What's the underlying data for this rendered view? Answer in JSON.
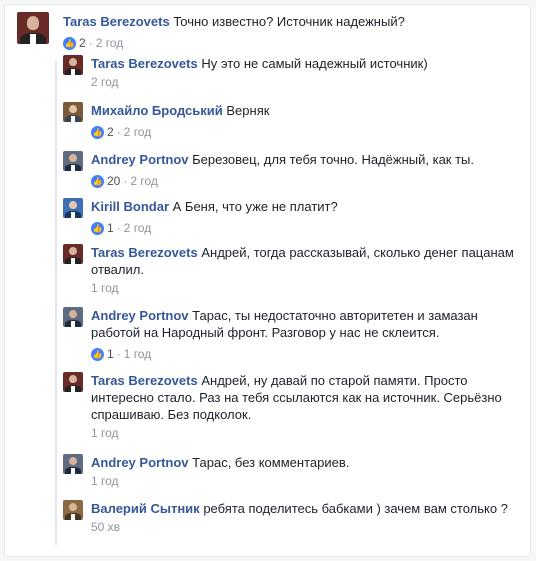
{
  "colors": {
    "author_name": "#365899",
    "text": "#1d2129",
    "meta": "#90949c",
    "like": "#4080ff"
  },
  "top_comment": {
    "author": "Taras Berezovets",
    "text": "Точно известно? Источник надежный?",
    "likes": "2",
    "separator": "·",
    "time": "2 год"
  },
  "replies": [
    {
      "author": "Taras Berezovets",
      "text": "Ну это не самый надежный источник)",
      "time": "2 год"
    },
    {
      "author": "Михайло Бродський",
      "text": "Верняк",
      "likes": "2",
      "separator": "·",
      "time": "2 год"
    },
    {
      "author": "Andrey Portnov",
      "text": "Березовец, для тебя точно. Надёжный, как ты.",
      "likes": "20",
      "separator": "·",
      "time": "2 год"
    },
    {
      "author": "Kirill Bondar",
      "text": "А Беня, что уже не платит?",
      "likes": "1",
      "separator": "·",
      "time": "2 год"
    },
    {
      "author": "Taras Berezovets",
      "text": "Андрей, тогда рассказывай, сколько денег пацанам отвалил.",
      "time": "1 год"
    },
    {
      "author": "Andrey Portnov",
      "text": "Тарас, ты недостаточно авторитетен и замазан работой на Народный фронт. Разговор у нас не склеится.",
      "likes": "1",
      "separator": "·",
      "time": "1 год"
    },
    {
      "author": "Taras Berezovets",
      "text": "Андрей, ну давай по старой памяти. Просто интересно стало. Раз на тебя ссылаются как на источник. Серьёзно спрашиваю. Без подколок.",
      "time": "1 год"
    },
    {
      "author": "Andrey Portnov",
      "text": "Тарас, без комментариев.",
      "time": "1 год"
    },
    {
      "author": "Валерий Сытник",
      "text": "ребята поделитесь бабками ) зачем вам столько ?",
      "time": "50 хв"
    }
  ]
}
